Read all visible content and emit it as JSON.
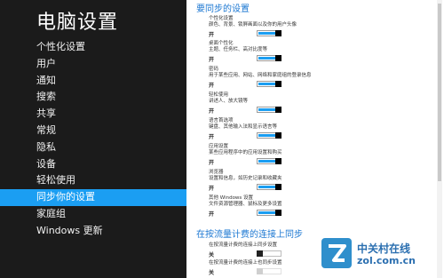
{
  "app": {
    "title": "电脑设置"
  },
  "sidebar": {
    "items": [
      {
        "label": "个性化设置"
      },
      {
        "label": "用户"
      },
      {
        "label": "通知"
      },
      {
        "label": "搜索"
      },
      {
        "label": "共享"
      },
      {
        "label": "常规"
      },
      {
        "label": "隐私"
      },
      {
        "label": "设备"
      },
      {
        "label": "轻松使用"
      },
      {
        "label": "同步你的设置",
        "selected": true
      },
      {
        "label": "家庭组"
      },
      {
        "label": "Windows 更新"
      }
    ]
  },
  "main": {
    "sync_section_title": "要同步的设置",
    "settings": [
      {
        "name": "个性化设置",
        "desc": "颜色、背景、锁屏画面以及你的用户头像",
        "state": "开"
      },
      {
        "name": "桌面个性化",
        "desc": "主题、任务栏、高对比度等",
        "state": "开"
      },
      {
        "name": "密码",
        "desc": "用于某些应用、网站、网络和家庭组的登录信息",
        "state": "开"
      },
      {
        "name": "轻松使用",
        "desc": "讲述人、放大镜等",
        "state": "开"
      },
      {
        "name": "语言首选项",
        "desc": "键盘、其他输入法和显示语言等",
        "state": "开"
      },
      {
        "name": "应用设置",
        "desc": "某些应用程序中的应用设置和购买",
        "state": "开"
      },
      {
        "name": "浏览器",
        "desc": "设置和信息，如历史记录和收藏夹",
        "state": "开"
      },
      {
        "name": "其他 Windows 设置",
        "desc": "文件资源管理器、鼠标及更多设置",
        "state": "开"
      }
    ],
    "metered_section_title": "在按流量计费的连接上同步",
    "metered": [
      {
        "name": "在按流量计费的连接上同步设置",
        "state": "关"
      },
      {
        "name": "在按流量计费的连接上也同步设置",
        "state": "关"
      }
    ]
  },
  "watermark": {
    "cn": "中关村在线",
    "url": "zol.com.cn"
  },
  "colors": {
    "sidebar_bg": "#1b1b1b",
    "accent": "#1b9ef2",
    "section_title": "#1b77d2"
  }
}
